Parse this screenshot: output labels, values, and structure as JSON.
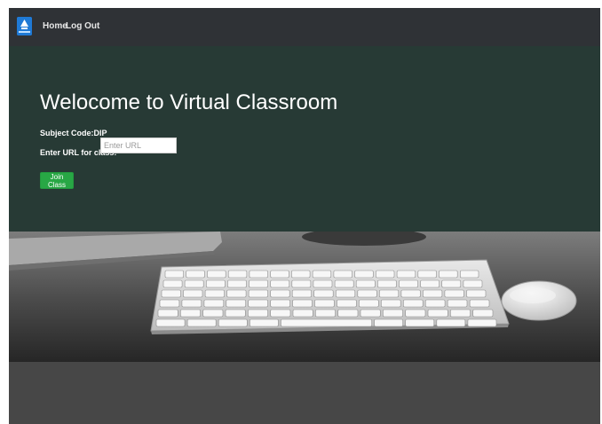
{
  "navbar": {
    "brand_icon": "classroom-logo-icon",
    "links": [
      {
        "label": "Home"
      },
      {
        "label": "Log Out"
      }
    ],
    "background": "#2f3236"
  },
  "hero": {
    "title": "Welocome to Virtual Classroom",
    "subject_code": "Subject Code:DIP",
    "url_label": "Enter URL for class:",
    "url_input": {
      "value": "",
      "placeholder": "Enter URL"
    },
    "join_button_label": "Join Class",
    "background": "#273a35",
    "button_color": "#28a745"
  },
  "banner": {
    "image": "keyboard-and-mouse-photo"
  }
}
